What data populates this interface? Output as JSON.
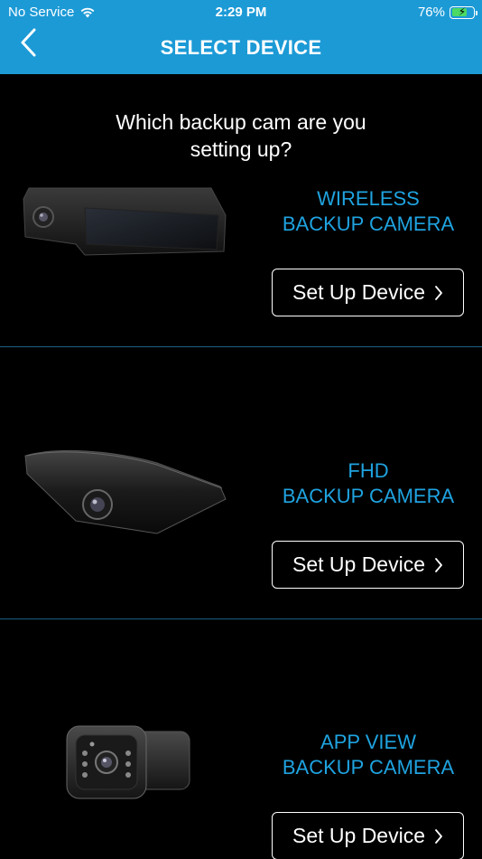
{
  "status": {
    "carrier": "No Service",
    "time": "2:29 PM",
    "battery_percent": "76%",
    "battery_level": 0.76
  },
  "header": {
    "title": "SELECT DEVICE",
    "back_icon": "chevron-left-icon",
    "background": "#1c9ad6"
  },
  "prompt": {
    "line1": "Which backup cam are you",
    "line2": "setting up?"
  },
  "devices": [
    {
      "name_line1": "WIRELESS",
      "name_line2": "BACKUP CAMERA",
      "button_label": "Set Up Device",
      "button_icon": "chevron-right-icon"
    },
    {
      "name_line1": "FHD",
      "name_line2": "BACKUP CAMERA",
      "button_label": "Set Up Device",
      "button_icon": "chevron-right-icon"
    },
    {
      "name_line1": "APP VIEW",
      "name_line2": "BACKUP CAMERA",
      "button_label": "Set Up Device",
      "button_icon": "chevron-right-icon"
    }
  ],
  "colors": {
    "accent": "#1fa3e0",
    "divider": "#1a5f86",
    "battery": "#4cd964"
  }
}
